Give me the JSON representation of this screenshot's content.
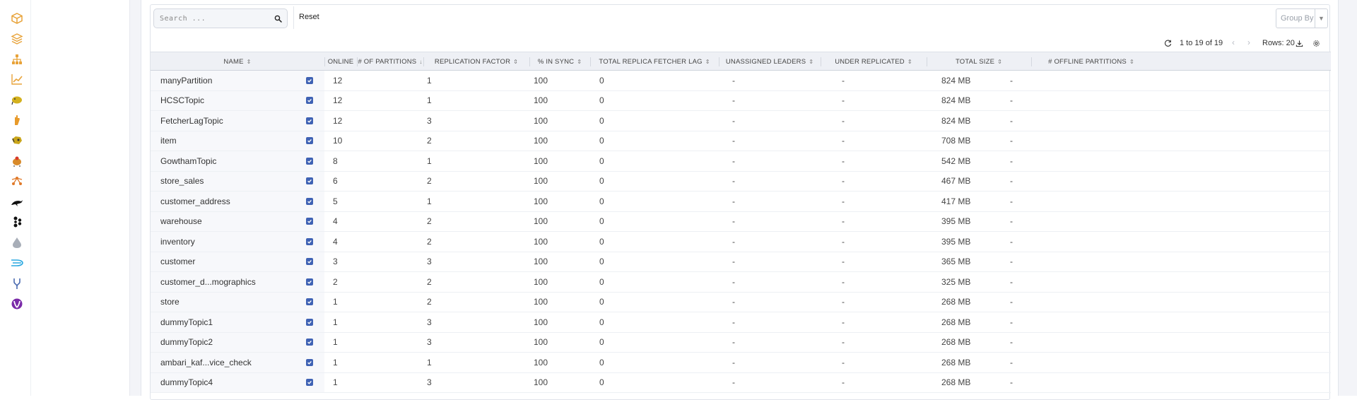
{
  "sidebar": {
    "icons": [
      {
        "name": "package-icon",
        "color": "#e8a33a"
      },
      {
        "name": "layers-icon",
        "color": "#e8a33a"
      },
      {
        "name": "hierarchy-icon",
        "color": "#e8a33a"
      },
      {
        "name": "trend-chart-icon",
        "color": "#e8a33a"
      },
      {
        "name": "hadoop-elephant-icon",
        "color": "#d4b11e"
      },
      {
        "name": "hand-icon",
        "color": "#e89a2a"
      },
      {
        "name": "hive-icon",
        "color": "#c9a51a"
      },
      {
        "name": "pig-icon",
        "color": "#d88a2a"
      },
      {
        "name": "nodes-icon",
        "color": "#e07a2a"
      },
      {
        "name": "dolphin-icon",
        "color": "#111111"
      },
      {
        "name": "kafka-icon",
        "color": "#111111"
      },
      {
        "name": "drop-icon",
        "color": "#a8aeb8"
      },
      {
        "name": "speed-icon",
        "color": "#2aa8e0"
      },
      {
        "name": "fork-icon",
        "color": "#4a6ab0"
      },
      {
        "name": "yarn-icon",
        "color": "#7a2aa8"
      }
    ]
  },
  "toolbar": {
    "search_placeholder": "Search ...",
    "reset_label": "Reset",
    "group_by_placeholder": "Group By",
    "range_label": "1 to 19 of 19",
    "rows_label": "Rows: 20"
  },
  "table": {
    "columns": [
      {
        "key": "name",
        "label": "NAME",
        "sort_icon": "⇕"
      },
      {
        "key": "online",
        "label": "ONLINE",
        "sort_icon": ""
      },
      {
        "key": "partitions",
        "label": "# OF PARTITIONS",
        "sort_icon": "↓"
      },
      {
        "key": "replication",
        "label": "REPLICATION FACTOR",
        "sort_icon": "⇕"
      },
      {
        "key": "insync",
        "label": "% IN SYNC",
        "sort_icon": "⇕"
      },
      {
        "key": "lag",
        "label": "TOTAL REPLICA FETCHER LAG",
        "sort_icon": "⇕"
      },
      {
        "key": "unassigned",
        "label": "UNASSIGNED LEADERS",
        "sort_icon": "⇕"
      },
      {
        "key": "underrep",
        "label": "UNDER REPLICATED",
        "sort_icon": "⇕"
      },
      {
        "key": "size",
        "label": "TOTAL SIZE",
        "sort_icon": "⇕"
      },
      {
        "key": "offline",
        "label": "# OFFLINE PARTITIONS",
        "sort_icon": "⇕"
      }
    ],
    "rows": [
      {
        "name": "manyPartition",
        "online": true,
        "partitions": "12",
        "replication": "1",
        "insync": "100",
        "lag": "0",
        "unassigned": "-",
        "underrep": "-",
        "size": "824 MB",
        "offline": "-"
      },
      {
        "name": "HCSCTopic",
        "online": true,
        "partitions": "12",
        "replication": "1",
        "insync": "100",
        "lag": "0",
        "unassigned": "-",
        "underrep": "-",
        "size": "824 MB",
        "offline": "-"
      },
      {
        "name": "FetcherLagTopic",
        "online": true,
        "partitions": "12",
        "replication": "3",
        "insync": "100",
        "lag": "0",
        "unassigned": "-",
        "underrep": "-",
        "size": "824 MB",
        "offline": "-"
      },
      {
        "name": "item",
        "online": true,
        "partitions": "10",
        "replication": "2",
        "insync": "100",
        "lag": "0",
        "unassigned": "-",
        "underrep": "-",
        "size": "708 MB",
        "offline": "-"
      },
      {
        "name": "GowthamTopic",
        "online": true,
        "partitions": "8",
        "replication": "1",
        "insync": "100",
        "lag": "0",
        "unassigned": "-",
        "underrep": "-",
        "size": "542 MB",
        "offline": "-"
      },
      {
        "name": "store_sales",
        "online": true,
        "partitions": "6",
        "replication": "2",
        "insync": "100",
        "lag": "0",
        "unassigned": "-",
        "underrep": "-",
        "size": "467 MB",
        "offline": "-"
      },
      {
        "name": "customer_address",
        "online": true,
        "partitions": "5",
        "replication": "1",
        "insync": "100",
        "lag": "0",
        "unassigned": "-",
        "underrep": "-",
        "size": "417 MB",
        "offline": "-"
      },
      {
        "name": "warehouse",
        "online": true,
        "partitions": "4",
        "replication": "2",
        "insync": "100",
        "lag": "0",
        "unassigned": "-",
        "underrep": "-",
        "size": "395 MB",
        "offline": "-"
      },
      {
        "name": "inventory",
        "online": true,
        "partitions": "4",
        "replication": "2",
        "insync": "100",
        "lag": "0",
        "unassigned": "-",
        "underrep": "-",
        "size": "395 MB",
        "offline": "-"
      },
      {
        "name": "customer",
        "online": true,
        "partitions": "3",
        "replication": "3",
        "insync": "100",
        "lag": "0",
        "unassigned": "-",
        "underrep": "-",
        "size": "365 MB",
        "offline": "-"
      },
      {
        "name": "customer_d...mographics",
        "online": true,
        "partitions": "2",
        "replication": "2",
        "insync": "100",
        "lag": "0",
        "unassigned": "-",
        "underrep": "-",
        "size": "325 MB",
        "offline": "-"
      },
      {
        "name": "store",
        "online": true,
        "partitions": "1",
        "replication": "2",
        "insync": "100",
        "lag": "0",
        "unassigned": "-",
        "underrep": "-",
        "size": "268 MB",
        "offline": "-"
      },
      {
        "name": "dummyTopic1",
        "online": true,
        "partitions": "1",
        "replication": "3",
        "insync": "100",
        "lag": "0",
        "unassigned": "-",
        "underrep": "-",
        "size": "268 MB",
        "offline": "-"
      },
      {
        "name": "dummyTopic2",
        "online": true,
        "partitions": "1",
        "replication": "3",
        "insync": "100",
        "lag": "0",
        "unassigned": "-",
        "underrep": "-",
        "size": "268 MB",
        "offline": "-"
      },
      {
        "name": "ambari_kaf...vice_check",
        "online": true,
        "partitions": "1",
        "replication": "1",
        "insync": "100",
        "lag": "0",
        "unassigned": "-",
        "underrep": "-",
        "size": "268 MB",
        "offline": "-"
      },
      {
        "name": "dummyTopic4",
        "online": true,
        "partitions": "1",
        "replication": "3",
        "insync": "100",
        "lag": "0",
        "unassigned": "-",
        "underrep": "-",
        "size": "268 MB",
        "offline": "-"
      }
    ]
  },
  "colors": {
    "accent": "#3f62b4",
    "header_bg": "#eef0f5",
    "name_col_bg": "#f7f8fb"
  }
}
